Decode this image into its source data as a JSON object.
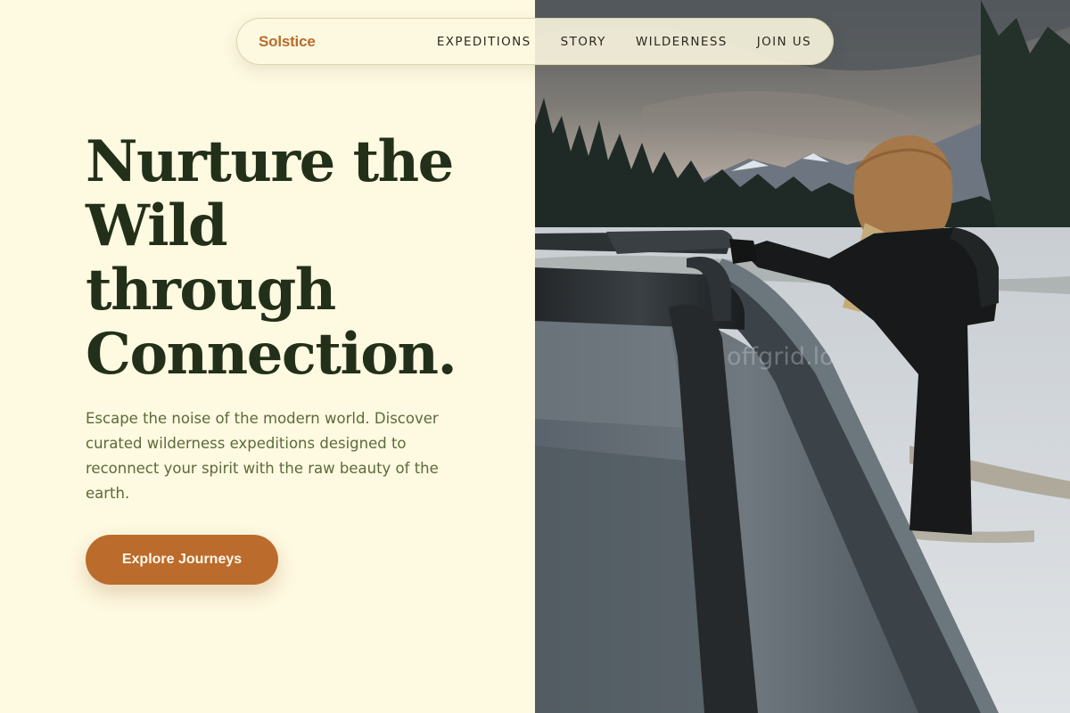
{
  "nav": {
    "brand": "Solstice",
    "links": [
      "EXPEDITIONS",
      "STORY",
      "WILDERNESS",
      "JOIN US"
    ]
  },
  "hero": {
    "headline_lines": [
      "Nurture the",
      "Wild",
      "through",
      "Connection."
    ],
    "subcopy": "Escape the noise of the modern world. Discover curated wilderness expeditions designed to reconnect your spirit with the raw beauty of the earth.",
    "cta_label": "Explore Journeys"
  },
  "photo": {
    "watermark": "offgrid.love"
  },
  "colors": {
    "background": "#fef9e1",
    "brand": "#b76c2c",
    "headline": "#233019",
    "subcopy": "#5b6a3c",
    "cta": "#bb6b2b"
  }
}
